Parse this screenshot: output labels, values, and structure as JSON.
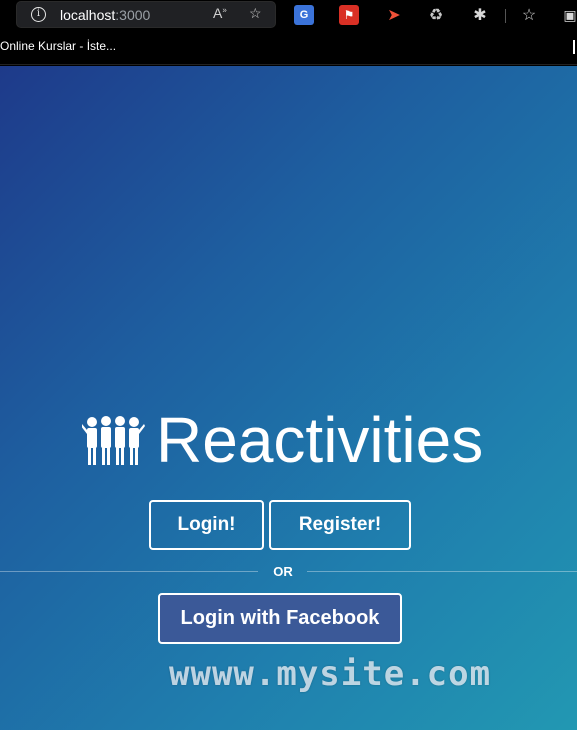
{
  "browser": {
    "url_host": "localhost",
    "url_port": ":3000",
    "bookmarks": [
      "Online Kurslar - İste..."
    ],
    "toolbar_icons": [
      "read-aloud-icon",
      "add-favorite-icon",
      "translate-extension-icon",
      "pdf-extension-icon",
      "swift-extension-icon",
      "recycle-extension-icon",
      "extensions-puzzle-icon",
      "favorites-icon",
      "collections-icon"
    ]
  },
  "page": {
    "title": "Reactivities",
    "login_label": "Login!",
    "register_label": "Register!",
    "divider_text": "OR",
    "facebook_label": "Login with Facebook",
    "watermark": "wwww.mysite.com"
  },
  "colors": {
    "gradient_start": "#1e3a8a",
    "gradient_end": "#2298b2",
    "facebook_button": "#3b5998"
  }
}
